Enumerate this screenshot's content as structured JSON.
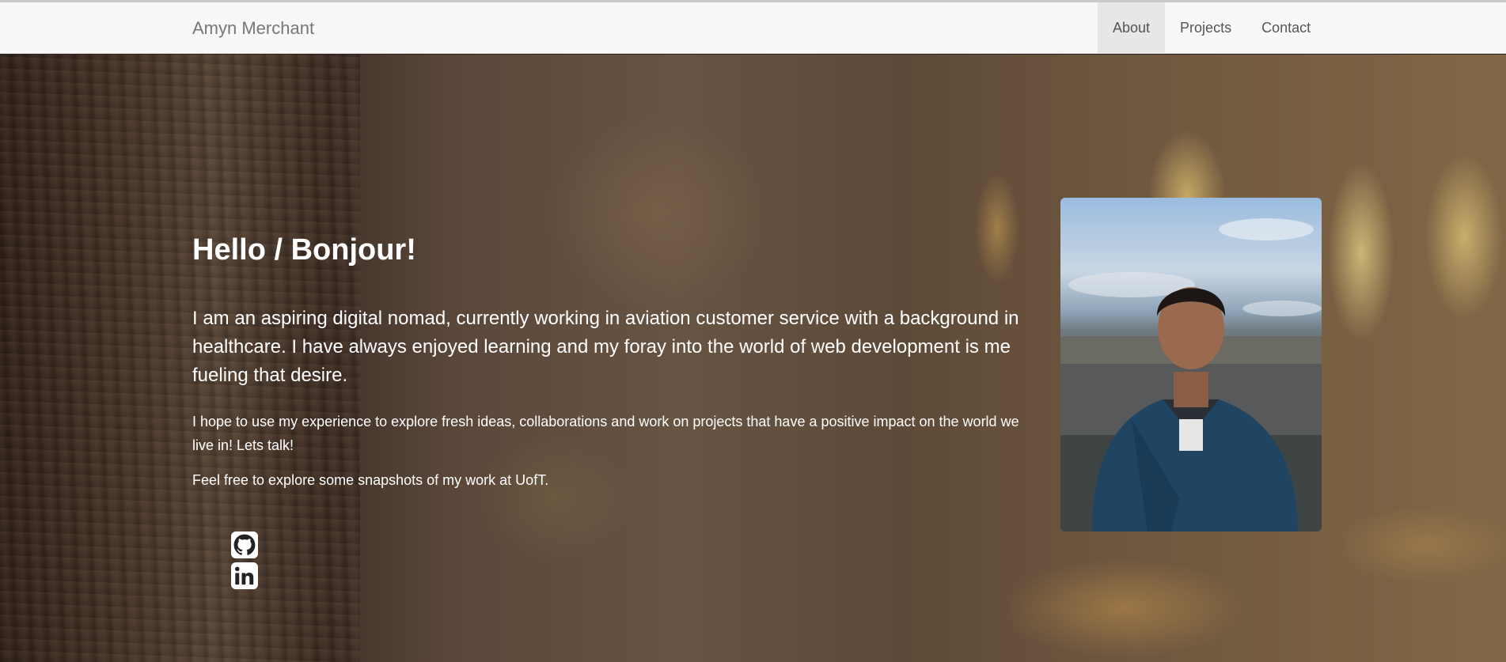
{
  "navbar": {
    "brand": "Amyn Merchant",
    "links": [
      {
        "label": "About",
        "active": true
      },
      {
        "label": "Projects",
        "active": false
      },
      {
        "label": "Contact",
        "active": false
      }
    ]
  },
  "hero": {
    "heading": "Hello / Bonjour!",
    "lead": "I am an aspiring digital nomad, currently working in aviation customer service with a background in healthcare. I have always enjoyed learning and my foray into the world of web development is me fueling that desire.",
    "paragraph1": "I hope to use my experience to explore fresh ideas, collaborations and work on projects that have a positive impact on the world we live in! Lets talk!",
    "paragraph2": "Feel free to explore some snapshots of my work at UofT."
  },
  "social": {
    "items": [
      {
        "icon": "github-icon"
      },
      {
        "icon": "linkedin-icon"
      }
    ]
  },
  "colors": {
    "navbar_bg": "#f8f8f8",
    "active_tab_bg": "#e7e7e7",
    "text_light": "#ffffff",
    "brand_text": "#777777"
  }
}
